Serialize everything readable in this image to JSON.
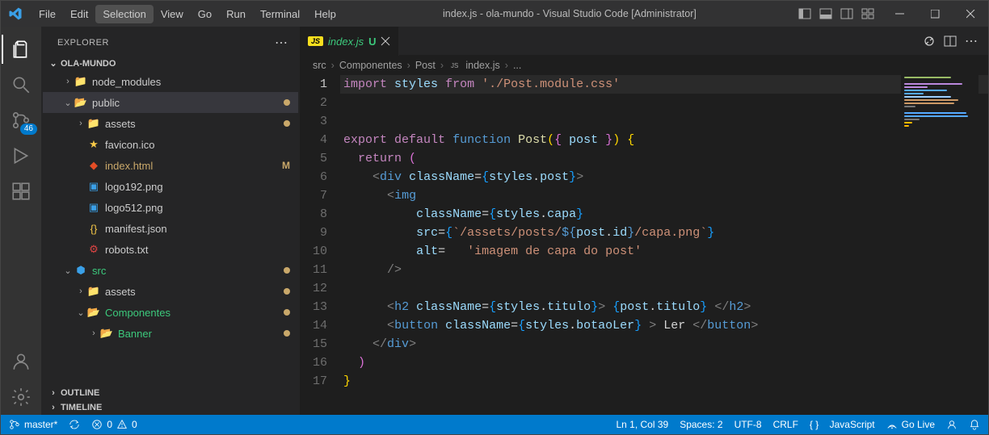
{
  "window": {
    "title": "index.js - ola-mundo - Visual Studio Code [Administrator]"
  },
  "menu": {
    "items": [
      "File",
      "Edit",
      "Selection",
      "View",
      "Go",
      "Run",
      "Terminal",
      "Help"
    ],
    "active_index": 2
  },
  "activity": {
    "scm_badge": "46"
  },
  "sidebar": {
    "title": "EXPLORER",
    "project": "OLA-MUNDO",
    "outline": "OUTLINE",
    "timeline": "TIMELINE",
    "tree": [
      {
        "depth": 1,
        "twisty": ">",
        "icon": "folder-green",
        "label": "node_modules",
        "git": ""
      },
      {
        "depth": 1,
        "twisty": "v",
        "icon": "folder-blue",
        "label": "public",
        "git": "dot",
        "selected": true
      },
      {
        "depth": 2,
        "twisty": ">",
        "icon": "folder-gold",
        "label": "assets",
        "git": "dot"
      },
      {
        "depth": 2,
        "twisty": "",
        "icon": "star",
        "label": "favicon.ico",
        "git": ""
      },
      {
        "depth": 2,
        "twisty": "",
        "icon": "html",
        "label": "index.html",
        "git": "M",
        "gitClass": "git-mod"
      },
      {
        "depth": 2,
        "twisty": "",
        "icon": "image",
        "label": "logo192.png",
        "git": ""
      },
      {
        "depth": 2,
        "twisty": "",
        "icon": "image",
        "label": "logo512.png",
        "git": ""
      },
      {
        "depth": 2,
        "twisty": "",
        "icon": "json",
        "label": "manifest.json",
        "git": ""
      },
      {
        "depth": 2,
        "twisty": "",
        "icon": "robot",
        "label": "robots.txt",
        "git": ""
      },
      {
        "depth": 1,
        "twisty": "v",
        "icon": "folder-react",
        "label": "src",
        "git": "dot",
        "class": "git-new"
      },
      {
        "depth": 2,
        "twisty": ">",
        "icon": "folder-gold",
        "label": "assets",
        "git": "dot"
      },
      {
        "depth": 2,
        "twisty": "v",
        "icon": "folder-grey",
        "label": "Componentes",
        "git": "dot",
        "class": "git-new"
      },
      {
        "depth": 3,
        "twisty": ">",
        "icon": "folder-grey",
        "label": "Banner",
        "git": "dot",
        "class": "git-new"
      }
    ]
  },
  "editor": {
    "tab": {
      "label": "index.js",
      "git": "U"
    },
    "breadcrumbs": [
      "src",
      "Componentes",
      "Post",
      "index.js",
      "..."
    ],
    "lines": [
      1,
      2,
      3,
      4,
      5,
      6,
      7,
      8,
      9,
      10,
      11,
      12,
      13,
      14,
      15,
      16,
      17
    ],
    "current_line": 1,
    "code": {
      "l1": {
        "a": "import",
        "b": "styles",
        "c": "from",
        "d": "'./Post.module.css'"
      },
      "l3": {
        "a": "export",
        "b": "default",
        "c": "function",
        "d": "Post",
        "e": "post"
      },
      "l4": {
        "a": "return"
      },
      "l5": {
        "a": "div",
        "b": "className",
        "c": "styles",
        "d": "post"
      },
      "l6": {
        "a": "img"
      },
      "l7": {
        "a": "className",
        "b": "styles",
        "c": "capa"
      },
      "l8": {
        "a": "src",
        "b": "`/assets/posts/",
        "c": "post",
        "d": "id",
        "e": "/capa.png`"
      },
      "l9": {
        "a": "alt",
        "b": "'imagem de capa do post'"
      },
      "l12": {
        "a": "h2",
        "b": "className",
        "c": "styles",
        "d": "titulo",
        "e": "post",
        "f": "titulo"
      },
      "l13": {
        "a": "button",
        "b": "className",
        "c": "styles",
        "d": "botaoLer",
        "e": "Ler"
      }
    }
  },
  "status": {
    "branch": "master*",
    "sync": "",
    "errors": "0",
    "warnings": "0",
    "cursor": "Ln 1, Col 39",
    "spaces": "Spaces: 2",
    "encoding": "UTF-8",
    "eol": "CRLF",
    "lang": "JavaScript",
    "golive": "Go Live"
  }
}
